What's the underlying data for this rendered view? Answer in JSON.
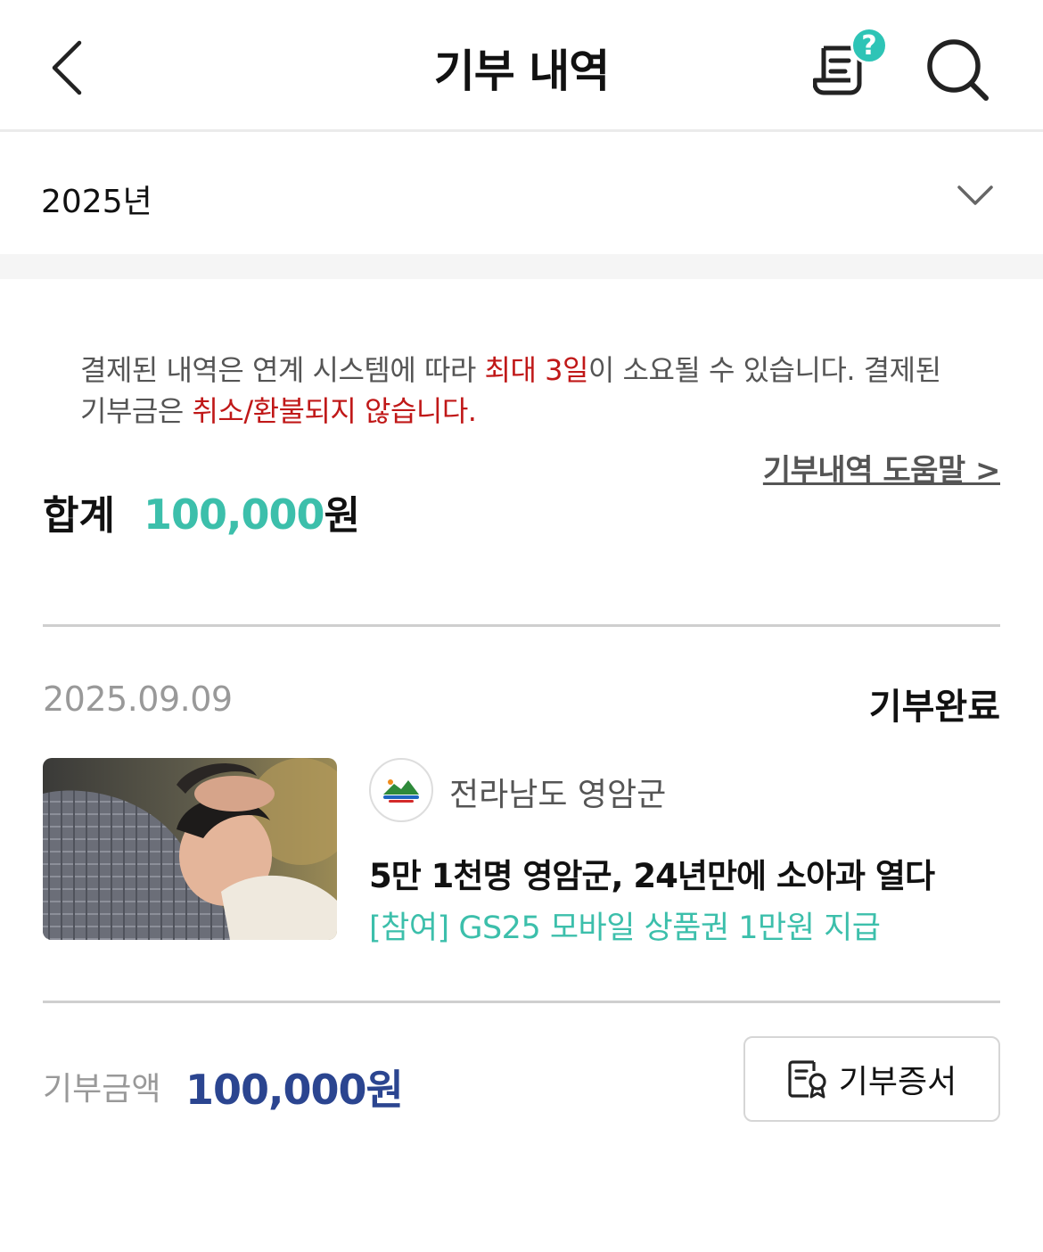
{
  "header": {
    "title": "기부 내역",
    "back_icon": "chevron-left-icon",
    "receipt_icon": "receipt-help-icon",
    "help_badge": "?",
    "search_icon": "search-icon"
  },
  "year_selector": {
    "selected": "2025년",
    "icon": "chevron-down-icon"
  },
  "notice": {
    "part1": "결제된 내역은 연계 시스템에 따라 ",
    "highlight1": "최대 3일",
    "part2": "이 소요될 수 있습니다. 결제된 기부금은 ",
    "highlight2": "취소/환불되지 않습니다.",
    "highlight_color": "#c01818"
  },
  "help_link": "기부내역 도움말 >",
  "summary": {
    "label": "합계",
    "amount": "100,000",
    "unit": "원",
    "accent_color": "#3cbfab"
  },
  "donation": {
    "date": "2025.09.09",
    "status": "기부완료",
    "org_name": "전라남도 영암군",
    "title": "5만 1천명 영암군, 24년만에 소아과 열다",
    "subtitle": "[참여] GS25 모바일 상품권 1만원 지급",
    "amount_label": "기부금액",
    "amount": "100,000원",
    "amount_color": "#2b4590",
    "cert_button": "기부증서",
    "cert_icon": "certificate-icon"
  }
}
